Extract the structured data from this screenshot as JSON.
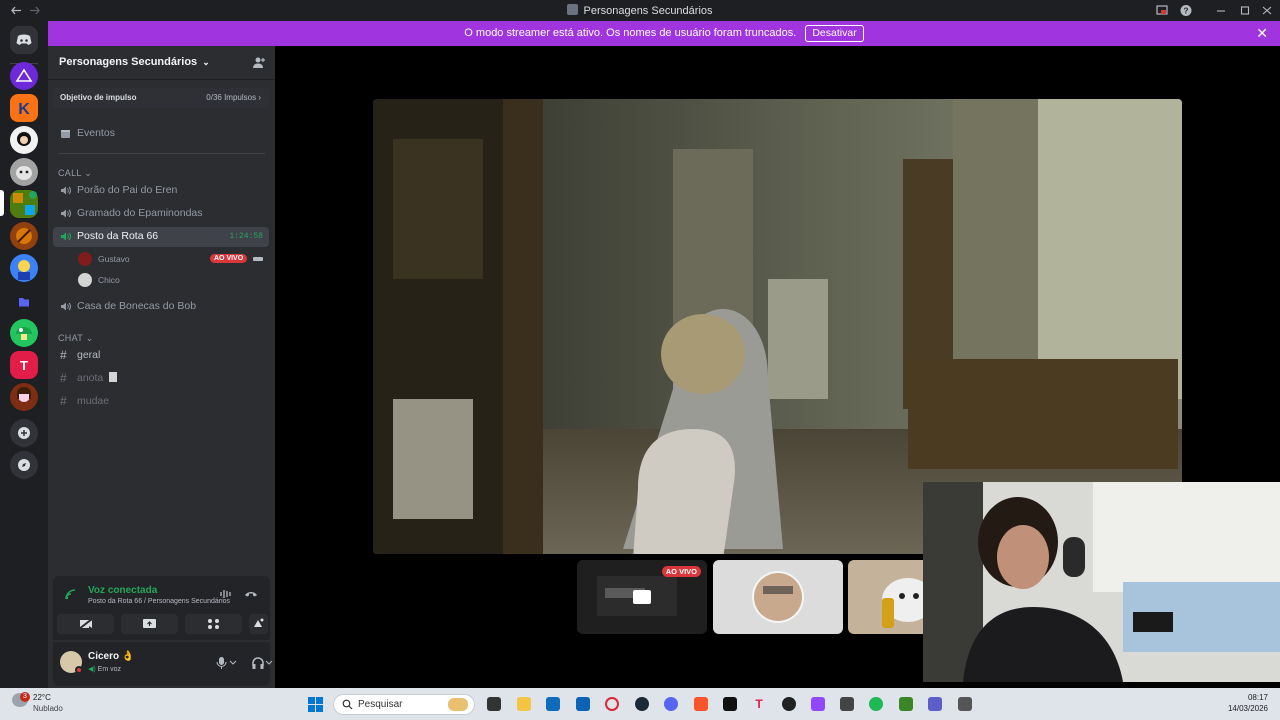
{
  "window": {
    "title": "Personagens Secundários"
  },
  "banner": {
    "message": "O modo streamer está ativo. Os nomes de usuário foram truncados.",
    "button": "Desativar"
  },
  "server": {
    "name": "Personagens Secundários",
    "boost_label": "Objetivo de impulso",
    "boost_value": "0/36 Impulsos",
    "events": "Eventos"
  },
  "categories": {
    "call": "CALL",
    "chat": "CHAT"
  },
  "voice_channels": [
    {
      "name": "Porão do Pai do Eren"
    },
    {
      "name": "Gramado do Epaminondas"
    },
    {
      "name": "Posto da Rota 66",
      "timer": "1:24:58"
    },
    {
      "name": "Casa de Bonecas do Bob"
    }
  ],
  "members": [
    {
      "name": "Gustavo",
      "badge": "AO VIVO"
    },
    {
      "name": "Chico"
    }
  ],
  "text_channels": [
    {
      "name": "geral"
    },
    {
      "name": "anota"
    },
    {
      "name": "mudae"
    }
  ],
  "voice_panel": {
    "status": "Voz conectada",
    "location": "Posto da Rota 66 / Personagens Secundários"
  },
  "user": {
    "name": "Cicero",
    "status": "Em voz"
  },
  "stage": {
    "thumb_live": "AO VIVO"
  },
  "taskbar": {
    "weather_temp": "22°C",
    "weather_desc": "Nublado",
    "weather_badge": "3",
    "search_placeholder": "Pesquisar",
    "time": "08:17",
    "date": "14/03/2026"
  },
  "colors": {
    "accent_purple": "#a035e0",
    "online_green": "#23a55a",
    "live_red": "#da373c",
    "sidebar_bg": "#2b2d31",
    "rail_bg": "#1e1f22"
  }
}
